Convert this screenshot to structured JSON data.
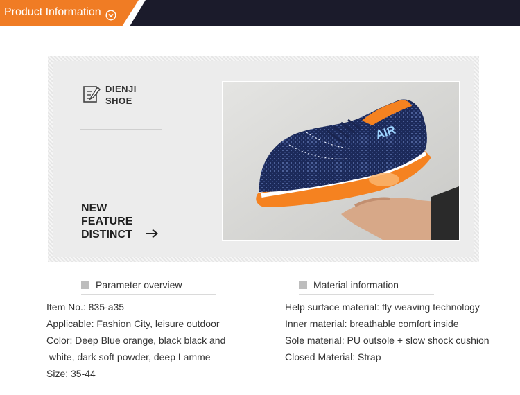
{
  "header": {
    "title": "Product Information",
    "icon": "chevron-down-circle-icon",
    "colors": {
      "accent": "#f07c24",
      "dark": "#1b1b2b"
    }
  },
  "showcase": {
    "brand_line1": "DIENJI",
    "brand_line2": "SHOE",
    "feature_line1": "NEW",
    "feature_line2": "FEATURE",
    "feature_line3": "DISTINCT",
    "arrow_icon": "arrow-right-icon",
    "doc_icon": "edit-document-icon",
    "photo": {
      "shoe_text": "AIR",
      "colors": {
        "shoe": "#1c2a5a",
        "sole": "#f58220"
      }
    }
  },
  "parameters": {
    "heading": "Parameter overview",
    "items": [
      "Item No.: 835-a35",
      "Applicable: Fashion City, leisure outdoor",
      "Color: Deep Blue orange, black black and",
      " white, dark soft powder, deep Lamme",
      "Size: 35-44"
    ]
  },
  "materials": {
    "heading": "Material information",
    "items": [
      "Help surface material: fly weaving technology",
      "Inner material: breathable comfort inside",
      "Sole material: PU outsole + slow shock cushion",
      "Closed Material: Strap"
    ]
  }
}
